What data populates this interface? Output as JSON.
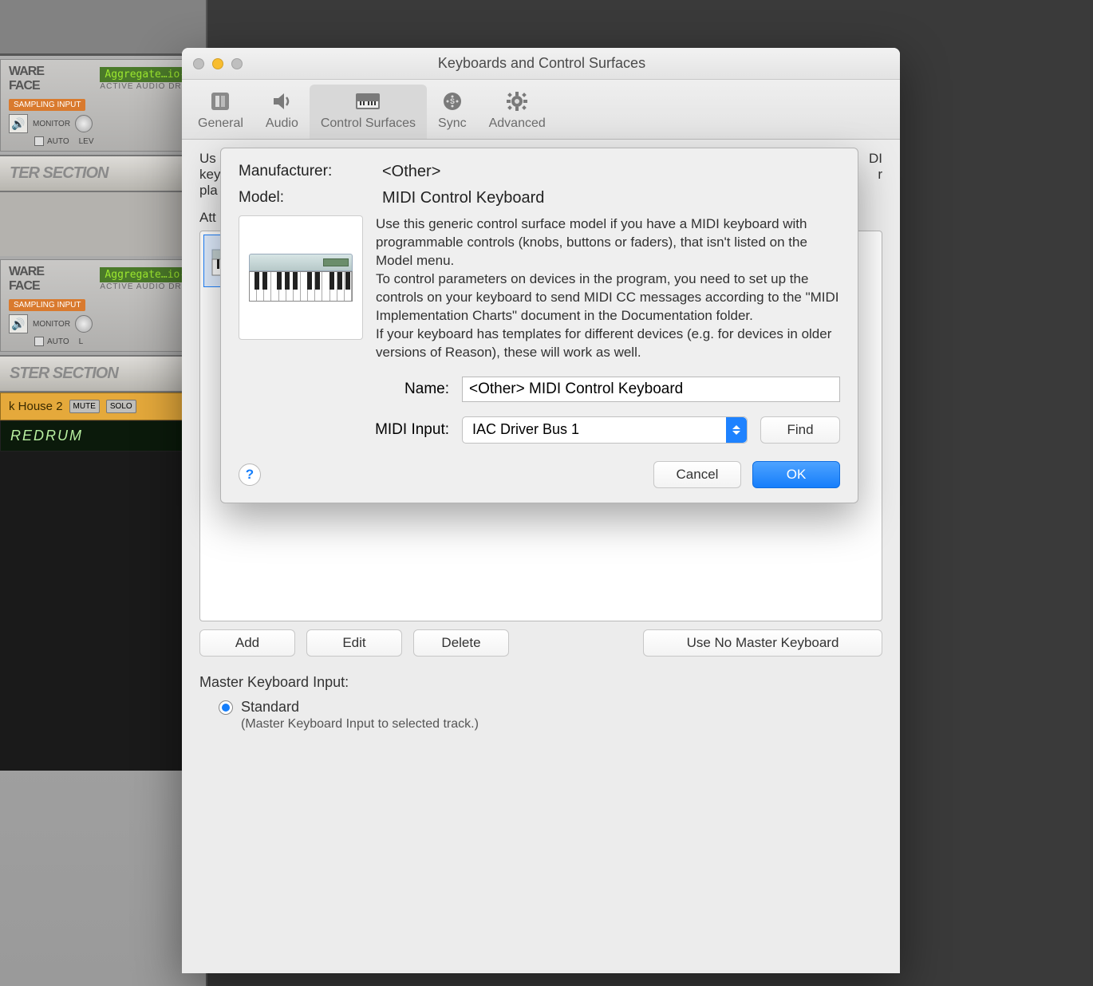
{
  "background": {
    "hardware_interface_title": "WARE\nFACE",
    "audio_device_lcd": "Aggregate…io-D",
    "active_audio_label": "ACTIVE AUDIO DR",
    "sampling_input_label": "SAMPLING INPUT",
    "monitor_label": "MONITOR",
    "auto_label": "AUTO",
    "lev_label": "LEV",
    "section_title_1": "TER SECTION",
    "section_title_2": "STER SECTION",
    "track_name": "k House 2",
    "mute_label": "MUTE",
    "solo_label": "SOLO",
    "redrum_label": "REDRUM"
  },
  "window": {
    "title": "Keyboards and Control Surfaces",
    "toolbar": {
      "general": "General",
      "audio": "Audio",
      "control_surfaces": "Control Surfaces",
      "sync": "Sync",
      "advanced": "Advanced"
    },
    "body_truncated_1": "Us",
    "body_truncated_2": "key",
    "body_truncated_3": "pla",
    "body_truncated_right1": "DI",
    "body_truncated_right2": "r",
    "attached_label": "Att",
    "buttons": {
      "add": "Add",
      "edit": "Edit",
      "delete": "Delete",
      "use_no_master": "Use No Master Keyboard"
    },
    "master_keyboard_label": "Master Keyboard Input:",
    "radio_standard": "Standard",
    "radio_standard_sub": "(Master Keyboard Input to selected track.)"
  },
  "sheet": {
    "manufacturer_label": "Manufacturer:",
    "manufacturer_value": "<Other>",
    "model_label": "Model:",
    "model_value": "MIDI Control Keyboard",
    "description": "Use this generic control surface model if you have a MIDI keyboard with programmable controls (knobs, buttons or faders), that isn't listed on the Model menu.\nTo control parameters on devices in the program, you need to set up the controls on your keyboard to send MIDI CC messages according to the \"MIDI Implementation Charts\" document in the Documentation folder.\nIf your keyboard has templates for different devices (e.g. for devices in older versions of Reason), these will work as well.",
    "name_label": "Name:",
    "name_value": "<Other> MIDI Control Keyboard",
    "midi_input_label": "MIDI Input:",
    "midi_input_value": "IAC Driver Bus 1",
    "find_button": "Find",
    "help_symbol": "?",
    "cancel_button": "Cancel",
    "ok_button": "OK"
  }
}
